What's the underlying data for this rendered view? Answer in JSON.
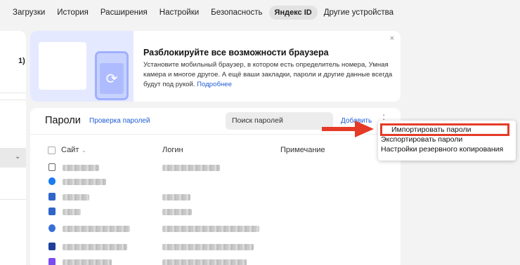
{
  "nav": {
    "tabs": [
      {
        "label": "Загрузки"
      },
      {
        "label": "История"
      },
      {
        "label": "Расширения"
      },
      {
        "label": "Настройки"
      },
      {
        "label": "Безопасность"
      },
      {
        "label": "Яндекс ID",
        "active": true
      },
      {
        "label": "Другие устройства"
      }
    ]
  },
  "sidebar": {
    "fragment_text": "1)"
  },
  "banner": {
    "title": "Разблокируйте все возможности браузера",
    "text": "Установите мобильный браузер, в котором есть определитель номера, Умная камера и многое другое. А ещё ваши закладки, пароли и другие данные всегда будут под рукой.",
    "link": "Подробнее",
    "close_icon": "×"
  },
  "passwords": {
    "title": "Пароли",
    "check_link": "Проверка паролей",
    "search_placeholder": "Поиск паролей",
    "add_label": "Добавить",
    "columns": {
      "site": "Сайт",
      "login": "Логин",
      "note": "Примечание"
    }
  },
  "menu": {
    "items": [
      {
        "label": "Импортировать пароли",
        "highlighted": true
      },
      {
        "label": "Экспортировать пароли"
      },
      {
        "label": "Настройки резервного копирования"
      }
    ]
  },
  "colors": {
    "accent_link": "#1f5cd6",
    "highlight_red": "#e53a27"
  },
  "icons": {
    "row_favicons": [
      "document-icon",
      "wifi-icon",
      "triangle-logo-icon",
      "triangle-logo-icon",
      "at-icon",
      "brand-logo-icon",
      "vector-logo-icon"
    ]
  }
}
